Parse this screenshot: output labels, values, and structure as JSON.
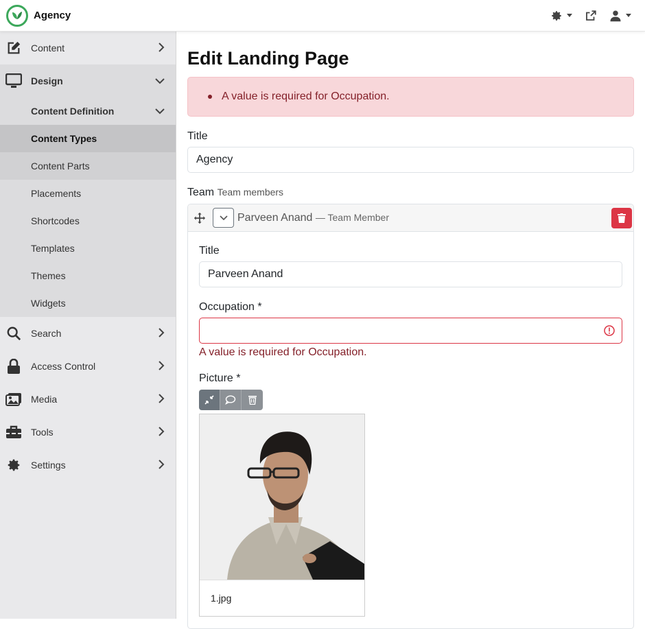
{
  "app": {
    "name": "Agency"
  },
  "topbar": {
    "settings_icon": "gear-icon",
    "external_icon": "external-link-icon",
    "user_icon": "user-icon"
  },
  "sidebar": {
    "items": [
      {
        "label": "Content",
        "icon": "edit-icon"
      },
      {
        "label": "Design",
        "icon": "monitor-icon"
      },
      {
        "label": "Search",
        "icon": "search-icon"
      },
      {
        "label": "Access Control",
        "icon": "lock-icon"
      },
      {
        "label": "Media",
        "icon": "images-icon"
      },
      {
        "label": "Tools",
        "icon": "toolbox-icon"
      },
      {
        "label": "Settings",
        "icon": "gear-icon"
      }
    ],
    "design_sub": {
      "group": "Content Definition",
      "items": [
        "Content Types",
        "Content Parts",
        "Placements",
        "Shortcodes",
        "Templates",
        "Themes",
        "Widgets"
      ]
    }
  },
  "page": {
    "title": "Edit Landing Page",
    "alert": "A value is required for Occupation.",
    "title_label": "Title",
    "title_value": "Agency",
    "team_label": "Team",
    "team_hint": "Team members",
    "member": {
      "name": "Parveen Anand",
      "type": "— Team Member",
      "title_label": "Title",
      "title_value": "Parveen Anand",
      "occupation_label": "Occupation *",
      "occupation_value": "",
      "occupation_error": "A value is required for Occupation.",
      "picture_label": "Picture *",
      "picture_file": "1.jpg"
    }
  },
  "colors": {
    "danger": "#dc3545",
    "alert_bg": "#f8d7da",
    "brand": "#3ca85b"
  }
}
